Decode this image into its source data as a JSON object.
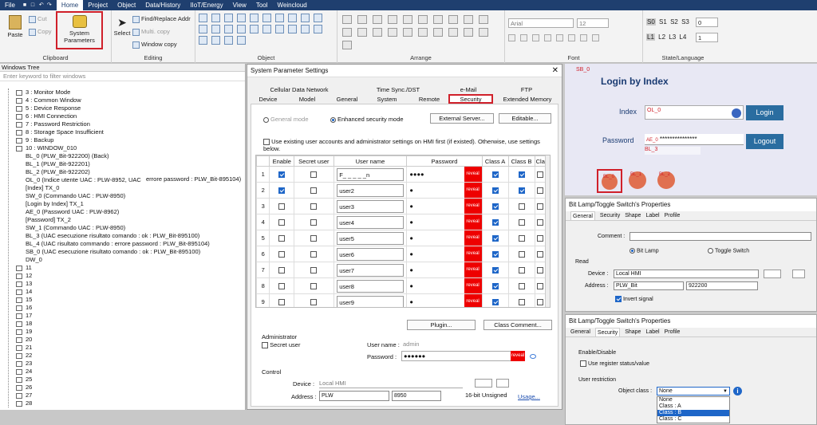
{
  "menu": {
    "items": [
      "File",
      "Home",
      "Project",
      "Object",
      "Data/History",
      "IIoT/Energy",
      "View",
      "Tool",
      "Weincloud"
    ],
    "active": "Home"
  },
  "ribbon": {
    "clipboard": {
      "label": "Clipboard",
      "paste": "Paste",
      "cut": "Cut",
      "copy": "Copy",
      "sysparam": "System Parameters"
    },
    "editing": {
      "label": "Editing",
      "select": "Select",
      "find": "Find/Replace Addr",
      "multi": "Multi. copy",
      "window": "Window copy"
    },
    "object": {
      "label": "Object"
    },
    "arrange": {
      "label": "Arrange"
    },
    "font": {
      "label": "Font",
      "family": "Arial",
      "size": "12"
    },
    "state": {
      "label": "State/Language",
      "s": [
        "S0",
        "S1",
        "S2",
        "S3"
      ],
      "l": [
        "L1",
        "L2",
        "L3",
        "L4"
      ],
      "s_val": "0",
      "l_val": "1"
    }
  },
  "wtree": {
    "title": "Windows Tree",
    "filter": "Enter keyword to filter windows",
    "items": [
      "3 : Monitor Mode",
      "4 : Common Window",
      "5 : Device Response",
      "6 : HMI Connection",
      "7 : Password Restriction",
      "8 : Storage Space Insufficient",
      "9 : Backup",
      "10 : WINDOW_010",
      "BL_0 (PLW_Bit-922200) (Back)",
      "BL_1 (PLW_Bit-922201)",
      "BL_2 (PLW_Bit-922202)",
      "OL_0 (Indice utente UAC : PLW-8952, UAC",
      "[Index] TX_0",
      "SW_0 (Commando UAC : PLW-8950)",
      "[Login by Index] TX_1",
      "AE_0 (Password UAC : PLW-8962)",
      "[Password] TX_2",
      "SW_1 (Commando UAC : PLW-8950)",
      "BL_3 (UAC esecuzione risultato comando : ok : PLW_Bit-895100)",
      "BL_4 (UAC risultato commando : errore password : PLW_Bit-895104)",
      "SB_0 (UAC esecuzione risultato comando : ok : PLW_Bit-895100)",
      "DW_0",
      "11",
      "12",
      "13",
      "14",
      "15",
      "16",
      "17",
      "18",
      "19",
      "20",
      "21",
      "22",
      "23",
      "24",
      "25",
      "26",
      "27",
      "28"
    ],
    "ol_suffix": "errore password : PLW_Bit-895104)"
  },
  "dialog": {
    "title": "System Parameter Settings",
    "tabs_row1": [
      "Cellular Data Network",
      "Time Sync./DST",
      "e-Mail",
      "FTP"
    ],
    "tabs_row2": [
      "Device",
      "Model",
      "General",
      "System",
      "Remote",
      "Security",
      "Extended Memory"
    ],
    "general_mode": "General mode",
    "enhanced_mode": "Enhanced security mode",
    "external_server": "External Server...",
    "editable": "Editable...",
    "use_existing": "Use existing user accounts and administrator settings on HMI first (if existed). Otherwise, use settings below.",
    "columns": [
      "Enable",
      "Secret user",
      "User name",
      "Password",
      "Class A",
      "Class B",
      "Cla"
    ],
    "rows": [
      {
        "n": "1",
        "enable": true,
        "secret": false,
        "user": "F_ _ _ _ _n",
        "pw": "●●●●",
        "a": true,
        "b": true
      },
      {
        "n": "2",
        "enable": true,
        "secret": false,
        "user": "user2",
        "pw": "●",
        "a": true,
        "b": true
      },
      {
        "n": "3",
        "enable": false,
        "secret": false,
        "user": "user3",
        "pw": "●",
        "a": true,
        "b": false
      },
      {
        "n": "4",
        "enable": false,
        "secret": false,
        "user": "user4",
        "pw": "●",
        "a": true,
        "b": false
      },
      {
        "n": "5",
        "enable": false,
        "secret": false,
        "user": "user5",
        "pw": "●",
        "a": true,
        "b": false
      },
      {
        "n": "6",
        "enable": false,
        "secret": false,
        "user": "user6",
        "pw": "●",
        "a": true,
        "b": false
      },
      {
        "n": "7",
        "enable": false,
        "secret": false,
        "user": "user7",
        "pw": "●",
        "a": true,
        "b": false
      },
      {
        "n": "8",
        "enable": false,
        "secret": false,
        "user": "user8",
        "pw": "●",
        "a": true,
        "b": false
      },
      {
        "n": "9",
        "enable": false,
        "secret": false,
        "user": "user9",
        "pw": "●",
        "a": true,
        "b": false
      }
    ],
    "reveal": "reveal",
    "plugin": "Plugin...",
    "class_comment": "Class Comment...",
    "admin": {
      "label": "Administrator",
      "secret": "Secret user",
      "uname_label": "User name :",
      "uname": "admin",
      "pw_label": "Password :",
      "pw": "●●●●●●"
    },
    "control": {
      "label": "Control",
      "device_label": "Device :",
      "device": "Local HMI",
      "address_label": "Address :",
      "addr_type": "PLW",
      "addr": "8950",
      "format": "16-bit Unsigned",
      "usage": "Usage..."
    }
  },
  "preview": {
    "sb": "SB_0",
    "title": "Login by Index",
    "index_label": "Index",
    "ol": "OL_0",
    "login": "Login",
    "ae": "AE_0",
    "password_label": "Password",
    "stars": "***************",
    "logout": "Logout",
    "bl3": "BL_3",
    "bl0": "BL_0",
    "bl1": "BL_1",
    "bl2": "BL_2"
  },
  "bl_panel1": {
    "title": "Bit Lamp/Toggle Switch's Properties",
    "tabs": [
      "General",
      "Security",
      "Shape",
      "Label",
      "Profile"
    ],
    "comment": "Comment :",
    "bit_lamp": "Bit Lamp",
    "toggle": "Toggle Switch",
    "read": "Read",
    "device_label": "Device :",
    "device": "Local HMI",
    "address_label": "Address :",
    "addr_type": "PLW_Bit",
    "addr": "922200",
    "invert": "Invert signal"
  },
  "bl_panel2": {
    "title": "Bit Lamp/Toggle Switch's Properties",
    "tabs": [
      "General",
      "Security",
      "Shape",
      "Label",
      "Profile"
    ],
    "enable": "Enable/Disable",
    "use_register": "Use register status/value",
    "user_restriction": "User restriction",
    "object_class_label": "Object class :",
    "selected": "None",
    "options": [
      "None",
      "Class : A",
      "Class : B",
      "Class : C"
    ]
  },
  "colors": {
    "accent": "#1f3f6f",
    "highlight": "#d0202a",
    "selection": "#1e66c8"
  }
}
